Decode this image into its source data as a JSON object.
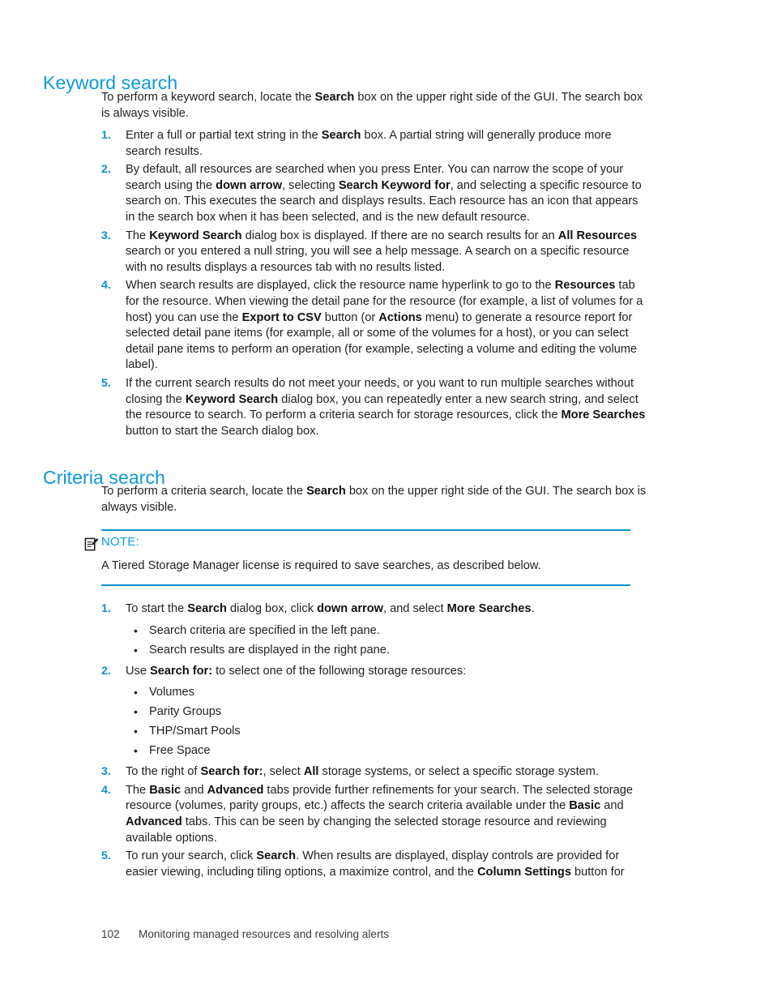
{
  "document": {
    "colors": {
      "heading": "#0e9ad6",
      "list_number": "#0c8fd0",
      "note_rule": "#0b8fce",
      "body_text": "#201f1e"
    }
  },
  "sections": [
    {
      "id": "keyword-search",
      "heading": "Keyword search",
      "intro": "To perform a keyword search, locate the <b>Search</b> box on the upper right side of the GUI. The search box is always visible.",
      "steps": [
        {
          "number": "1.",
          "html": "Enter a full or partial text string in the <b>Search</b> box. A partial string will generally produce more search results."
        },
        {
          "number": "2.",
          "html": "By default, all resources are searched when you press Enter. You can narrow the scope of your search using the <b>down arrow</b>, selecting <b>Search Keyword for</b>, and selecting a specific resource to search on. This executes the search and displays results. Each resource has an icon that appears in the search box when it has been selected, and is the new default resource."
        },
        {
          "number": "3.",
          "html": "The <b>Keyword Search</b> dialog box is displayed. If there are no search results for an <b>All Resources</b> search or you entered a null string, you will see a help message. A search on a specific resource with no results displays a resources tab with no results listed."
        },
        {
          "number": "4.",
          "html": "When search results are displayed, click the resource name hyperlink to go to the <b>Resources</b> tab for the resource. When viewing the detail pane for the resource (for example, a list of volumes for a host) you can use the <b>Export to CSV</b> button (or <b>Actions</b> menu) to generate a resource report for selected detail pane items (for example, all or some of the volumes for a host), or you can select detail pane items to perform an operation (for example, selecting a volume and editing the volume label)."
        },
        {
          "number": "5.",
          "html": "If the current search results do not meet your needs, or you want to run multiple searches without closing the <b>Keyword Search</b> dialog box, you can repeatedly enter a new search string, and select the resource to search. To perform a criteria search for storage resources, click the <b>More Searches</b> button to start the Search dialog box."
        }
      ]
    },
    {
      "id": "criteria-search",
      "heading": "Criteria search",
      "intro": "To perform a criteria search, locate the <b>Search</b> box on the upper right side of the GUI. The search box is always visible.",
      "note": {
        "icon": "note-page-pencil-icon",
        "label": "NOTE:",
        "text": "A Tiered Storage Manager license is required to save searches, as described below."
      },
      "steps": [
        {
          "number": "1.",
          "html": "To start the <b>Search</b> dialog box, click <b>down arrow</b>, and select <b>More Searches</b>.",
          "bullets": [
            "Search criteria are specified in the left pane.",
            "Search results are displayed in the right pane."
          ]
        },
        {
          "number": "2.",
          "html": "Use <b>Search for:</b> to select one of the following storage resources:",
          "bullets": [
            "Volumes",
            "Parity Groups",
            "THP/Smart Pools",
            "Free Space"
          ]
        },
        {
          "number": "3.",
          "html": "To the right of <b>Search for:</b>, select <b>All</b> storage systems, or select a specific storage system."
        },
        {
          "number": "4.",
          "html": "The <b>Basic</b> and <b>Advanced</b> tabs provide further refinements for your search. The selected storage resource (volumes, parity groups, etc.) affects the search criteria available under the <b>Basic</b> and <b>Advanced</b> tabs. This can be seen by changing the selected storage resource and reviewing available options."
        },
        {
          "number": "5.",
          "html": "To run your search, click <b>Search</b>. When results are displayed, display controls are provided for easier viewing, including tiling options, a maximize control, and the <b>Column Settings</b> button for"
        }
      ]
    }
  ],
  "footer": {
    "page_number": "102",
    "running_title": "Monitoring managed resources and resolving alerts"
  }
}
